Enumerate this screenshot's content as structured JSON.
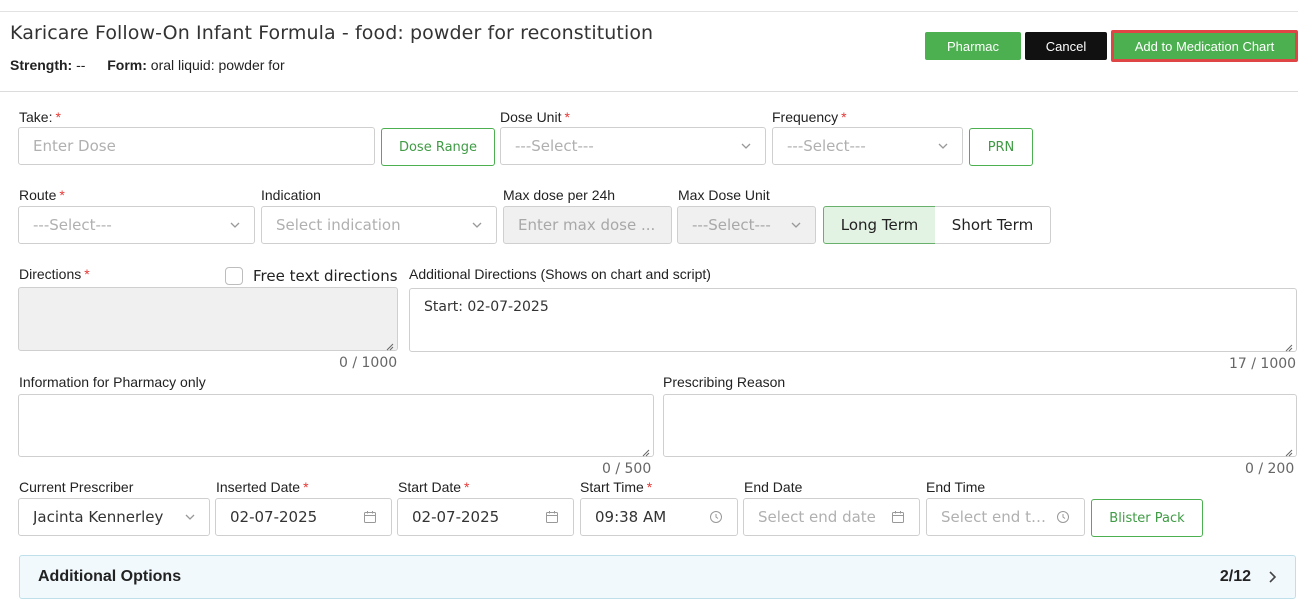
{
  "header": {
    "title": "Karicare Follow-On Infant Formula - food: powder for reconstitution",
    "strength_label": "Strength:",
    "strength_value": "--",
    "form_label": "Form:",
    "form_value": "oral liquid: powder for",
    "pharmac_label": "Pharmac",
    "cancel_label": "Cancel",
    "add_label": "Add to Medication Chart"
  },
  "row1": {
    "take_label": "Take:",
    "take_placeholder": "Enter Dose",
    "dose_range_label": "Dose Range",
    "dose_unit_label": "Dose Unit",
    "dose_unit_value": "---Select---",
    "frequency_label": "Frequency",
    "frequency_value": "---Select---",
    "prn_label": "PRN"
  },
  "row2": {
    "route_label": "Route",
    "route_value": "---Select---",
    "indication_label": "Indication",
    "indication_placeholder": "Select indication",
    "max_dose_label": "Max dose per 24h",
    "max_dose_placeholder": "Enter max dose ...",
    "max_unit_label": "Max Dose Unit",
    "max_unit_value": "---Select---",
    "long_term_label": "Long Term",
    "short_term_label": "Short Term"
  },
  "row3": {
    "directions_label": "Directions",
    "free_text_label": "Free text directions",
    "directions_counter": "0 / 1000",
    "additional_label": "Additional Directions (Shows on chart and script)",
    "additional_value": "Start: 02-07-2025",
    "additional_counter": "17 / 1000"
  },
  "row4": {
    "pharmacy_label": "Information for Pharmacy only",
    "pharmacy_counter": "0 / 500",
    "reason_label": "Prescribing Reason",
    "reason_counter": "0 / 200"
  },
  "row5": {
    "prescriber_label": "Current Prescriber",
    "prescriber_value": "Jacinta Kennerley",
    "inserted_label": "Inserted Date",
    "inserted_value": "02-07-2025",
    "start_date_label": "Start Date",
    "start_date_value": "02-07-2025",
    "start_time_label": "Start Time",
    "start_time_value": "09:38 AM",
    "end_date_label": "End Date",
    "end_date_placeholder": "Select end date",
    "end_time_label": "End Time",
    "end_time_placeholder": "Select end ti...",
    "blister_label": "Blister Pack"
  },
  "accordion": {
    "title": "Additional Options",
    "count": "2/12"
  },
  "required_marker": "*",
  "colors": {
    "accent_green": "#4caf50",
    "required_red": "#e53935",
    "highlight_red": "#e04545",
    "active_segment": "#e3f3e3"
  }
}
